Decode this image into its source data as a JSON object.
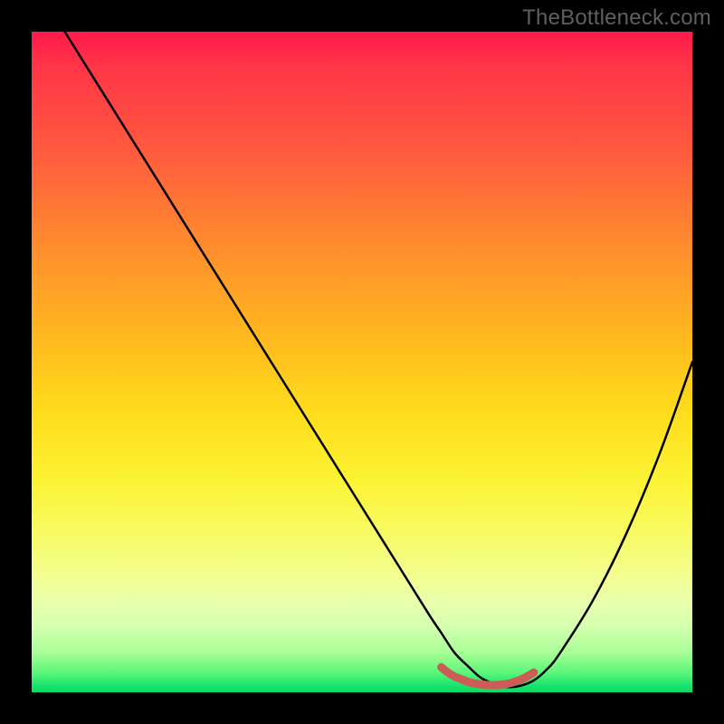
{
  "watermark": {
    "text": "TheBottleneck.com"
  },
  "colors": {
    "frame": "#000000",
    "curve_stroke": "#000000",
    "optimal_stroke": "#cc5c56",
    "gradient_top": "#ff1a4b",
    "gradient_bottom": "#0cd866"
  },
  "chart_data": {
    "type": "line",
    "title": "",
    "xlabel": "",
    "ylabel": "",
    "xlim": [
      0,
      100
    ],
    "ylim": [
      0,
      100
    ],
    "grid": false,
    "legend_position": "none",
    "series": [
      {
        "name": "bottleneck-curve",
        "x": [
          0,
          5,
          10,
          15,
          20,
          25,
          30,
          35,
          40,
          45,
          50,
          55,
          60,
          62,
          64,
          66,
          68,
          70,
          72,
          74,
          76,
          78,
          80,
          85,
          90,
          95,
          100
        ],
        "y": [
          108,
          100,
          92,
          84,
          76,
          68,
          60,
          52,
          44,
          36,
          28,
          20,
          12,
          9,
          6,
          4,
          2.2,
          1.3,
          0.8,
          1.0,
          1.8,
          3.5,
          6,
          14,
          24,
          36,
          50
        ]
      },
      {
        "name": "optimal-zone",
        "x": [
          62,
          63,
          64,
          65,
          66,
          67,
          68,
          69,
          70,
          71,
          72,
          73,
          74,
          75,
          76
        ],
        "y": [
          3.8,
          3.0,
          2.4,
          2.0,
          1.6,
          1.35,
          1.2,
          1.12,
          1.1,
          1.15,
          1.3,
          1.55,
          1.9,
          2.4,
          3.0
        ]
      }
    ],
    "annotations": []
  }
}
